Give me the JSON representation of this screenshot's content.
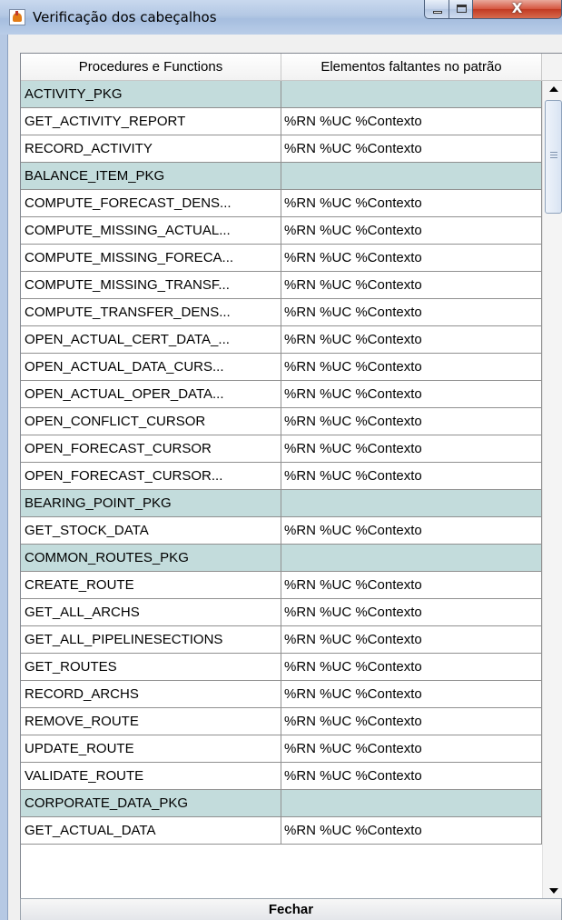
{
  "window": {
    "title": "Verificação dos cabeçalhos",
    "icon": "java-cup-icon",
    "close_glyph": "X"
  },
  "table": {
    "columns": [
      "Procedures e Functions",
      "Elementos faltantes no patrão"
    ],
    "rows": [
      {
        "name": "ACTIVITY_PKG",
        "missing": "",
        "group": true
      },
      {
        "name": "GET_ACTIVITY_REPORT",
        "missing": "%RN %UC %Contexto",
        "group": false
      },
      {
        "name": "RECORD_ACTIVITY",
        "missing": "%RN %UC %Contexto",
        "group": false
      },
      {
        "name": "BALANCE_ITEM_PKG",
        "missing": "",
        "group": true
      },
      {
        "name": "COMPUTE_FORECAST_DENS...",
        "missing": "%RN %UC %Contexto",
        "group": false
      },
      {
        "name": "COMPUTE_MISSING_ACTUAL...",
        "missing": "%RN %UC %Contexto",
        "group": false
      },
      {
        "name": "COMPUTE_MISSING_FORECA...",
        "missing": "%RN %UC %Contexto",
        "group": false
      },
      {
        "name": "COMPUTE_MISSING_TRANSF...",
        "missing": "%RN %UC %Contexto",
        "group": false
      },
      {
        "name": "COMPUTE_TRANSFER_DENS...",
        "missing": "%RN %UC %Contexto",
        "group": false
      },
      {
        "name": "OPEN_ACTUAL_CERT_DATA_...",
        "missing": "%RN %UC %Contexto",
        "group": false
      },
      {
        "name": "OPEN_ACTUAL_DATA_CURS...",
        "missing": "%RN %UC %Contexto",
        "group": false
      },
      {
        "name": "OPEN_ACTUAL_OPER_DATA...",
        "missing": "%RN %UC %Contexto",
        "group": false
      },
      {
        "name": "OPEN_CONFLICT_CURSOR",
        "missing": "%RN %UC %Contexto",
        "group": false
      },
      {
        "name": "OPEN_FORECAST_CURSOR",
        "missing": "%RN %UC %Contexto",
        "group": false
      },
      {
        "name": "OPEN_FORECAST_CURSOR...",
        "missing": "%RN %UC %Contexto",
        "group": false
      },
      {
        "name": "BEARING_POINT_PKG",
        "missing": "",
        "group": true
      },
      {
        "name": "GET_STOCK_DATA",
        "missing": "%RN %UC %Contexto",
        "group": false
      },
      {
        "name": "COMMON_ROUTES_PKG",
        "missing": "",
        "group": true
      },
      {
        "name": "CREATE_ROUTE",
        "missing": "%RN %UC %Contexto",
        "group": false
      },
      {
        "name": "GET_ALL_ARCHS",
        "missing": "%RN %UC %Contexto",
        "group": false
      },
      {
        "name": "GET_ALL_PIPELINESECTIONS",
        "missing": "%RN %UC %Contexto",
        "group": false
      },
      {
        "name": "GET_ROUTES",
        "missing": "%RN %UC %Contexto",
        "group": false
      },
      {
        "name": "RECORD_ARCHS",
        "missing": "%RN %UC %Contexto",
        "group": false
      },
      {
        "name": "REMOVE_ROUTE",
        "missing": "%RN %UC %Contexto",
        "group": false
      },
      {
        "name": "UPDATE_ROUTE",
        "missing": "%RN %UC %Contexto",
        "group": false
      },
      {
        "name": "VALIDATE_ROUTE",
        "missing": "%RN %UC %Contexto",
        "group": false
      },
      {
        "name": "CORPORATE_DATA_PKG",
        "missing": "",
        "group": true
      },
      {
        "name": "GET_ACTUAL_DATA",
        "missing": "%RN %UC %Contexto",
        "group": false
      }
    ]
  },
  "colors": {
    "group_row_bg": "#c3dcdc",
    "grid_line": "#909090"
  },
  "footer": {
    "close_label": "Fechar"
  }
}
